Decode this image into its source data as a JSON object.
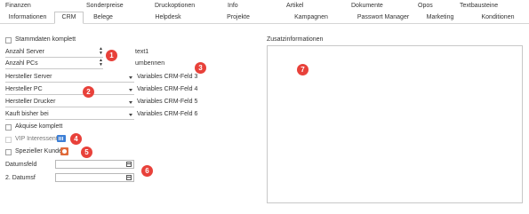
{
  "tabs_row1": [
    {
      "label": "Finanzen"
    },
    {
      "label": "Sonderpreise"
    },
    {
      "label": "Druckoptionen"
    },
    {
      "label": "Info"
    },
    {
      "label": "Artikel"
    },
    {
      "label": "Dokumente"
    },
    {
      "label": "Opos"
    },
    {
      "label": "Textbausteine"
    }
  ],
  "tabs_row2": [
    {
      "label": "Informationen"
    },
    {
      "label": "CRM",
      "active": true
    },
    {
      "label": "Belege"
    },
    {
      "label": "Helpdesk"
    },
    {
      "label": "Projekte"
    },
    {
      "label": "Kampagnen"
    },
    {
      "label": "Passwort Manager"
    },
    {
      "label": "Marketing"
    },
    {
      "label": "Konditionen"
    }
  ],
  "crm": {
    "stammdaten_label": "Stammdaten komplett",
    "anzahl_server_label": "Anzahl Server",
    "anzahl_server_text": "text1",
    "anzahl_pcs_label": "Anzahl PCs",
    "anzahl_pcs_text": "umbennen",
    "hersteller_server_label": "Hersteller Server",
    "hersteller_server_value": "Variables CRM-Feld 3",
    "hersteller_pc_label": "Hersteller PC",
    "hersteller_pc_value": "Variables CRM-Feld 4",
    "hersteller_drucker_label": "Hersteller Drucker",
    "hersteller_drucker_value": "Variables CRM-Feld 5",
    "kauft_bisher_label": "Kauft bisher bei",
    "kauft_bisher_value": "Variables CRM-Feld 6",
    "akquise_label": "Akquise komplett",
    "vip_label": "VIP Interessent",
    "spezieller_label": "Spezieller Kunde",
    "datumsfeld_label": "Datumsfeld",
    "datumsf2_label": "2. Datumsf"
  },
  "zusatz": {
    "label": "Zusatzinformationen"
  },
  "markers": [
    "1",
    "2",
    "3",
    "4",
    "5",
    "6",
    "7"
  ],
  "colors": {
    "marker": "#e8413a",
    "border": "#c8c8c8"
  },
  "icons": {
    "vip": "vip-badge-icon",
    "special": "special-customer-icon",
    "calendar": "calendar-icon"
  }
}
